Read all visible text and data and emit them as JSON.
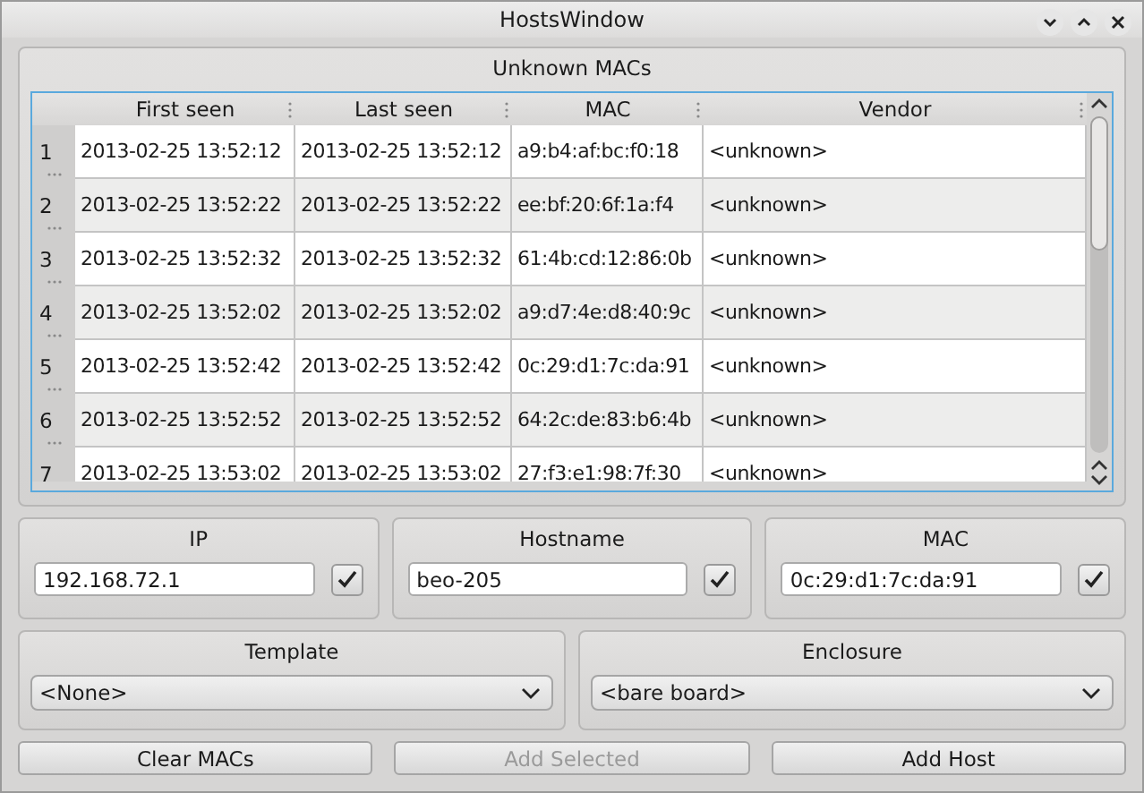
{
  "window": {
    "title": "HostsWindow"
  },
  "unknown_macs": {
    "title": "Unknown MACs",
    "columns": [
      "First seen",
      "Last seen",
      "MAC",
      "Vendor"
    ],
    "rows": [
      {
        "number": "1",
        "cells": [
          "2013-02-25 13:52:12",
          "2013-02-25 13:52:12",
          "a9:b4:af:bc:f0:18",
          "<unknown>"
        ]
      },
      {
        "number": "2",
        "cells": [
          "2013-02-25 13:52:22",
          "2013-02-25 13:52:22",
          "ee:bf:20:6f:1a:f4",
          "<unknown>"
        ]
      },
      {
        "number": "3",
        "cells": [
          "2013-02-25 13:52:32",
          "2013-02-25 13:52:32",
          "61:4b:cd:12:86:0b",
          "<unknown>"
        ]
      },
      {
        "number": "4",
        "cells": [
          "2013-02-25 13:52:02",
          "2013-02-25 13:52:02",
          "a9:d7:4e:d8:40:9c",
          "<unknown>"
        ]
      },
      {
        "number": "5",
        "cells": [
          "2013-02-25 13:52:42",
          "2013-02-25 13:52:42",
          "0c:29:d1:7c:da:91",
          "<unknown>"
        ]
      },
      {
        "number": "6",
        "cells": [
          "2013-02-25 13:52:52",
          "2013-02-25 13:52:52",
          "64:2c:de:83:b6:4b",
          "<unknown>"
        ]
      },
      {
        "number": "7",
        "cells": [
          "2013-02-25 13:53:02",
          "2013-02-25 13:53:02",
          "27:f3:e1:98:7f:30",
          "<unknown>"
        ]
      }
    ]
  },
  "fields": [
    {
      "title": "IP",
      "value": "192.168.72.1",
      "checked": true
    },
    {
      "title": "Hostname",
      "value": "beo-205",
      "checked": true
    },
    {
      "title": "MAC",
      "value": "0c:29:d1:7c:da:91",
      "checked": true
    }
  ],
  "selects": [
    {
      "title": "Template",
      "value": "<None>"
    },
    {
      "title": "Enclosure",
      "value": "<bare board>"
    }
  ],
  "buttons": [
    {
      "label": "Clear MACs",
      "disabled": false
    },
    {
      "label": "Add Selected",
      "disabled": true
    },
    {
      "label": "Add Host",
      "disabled": false
    }
  ]
}
